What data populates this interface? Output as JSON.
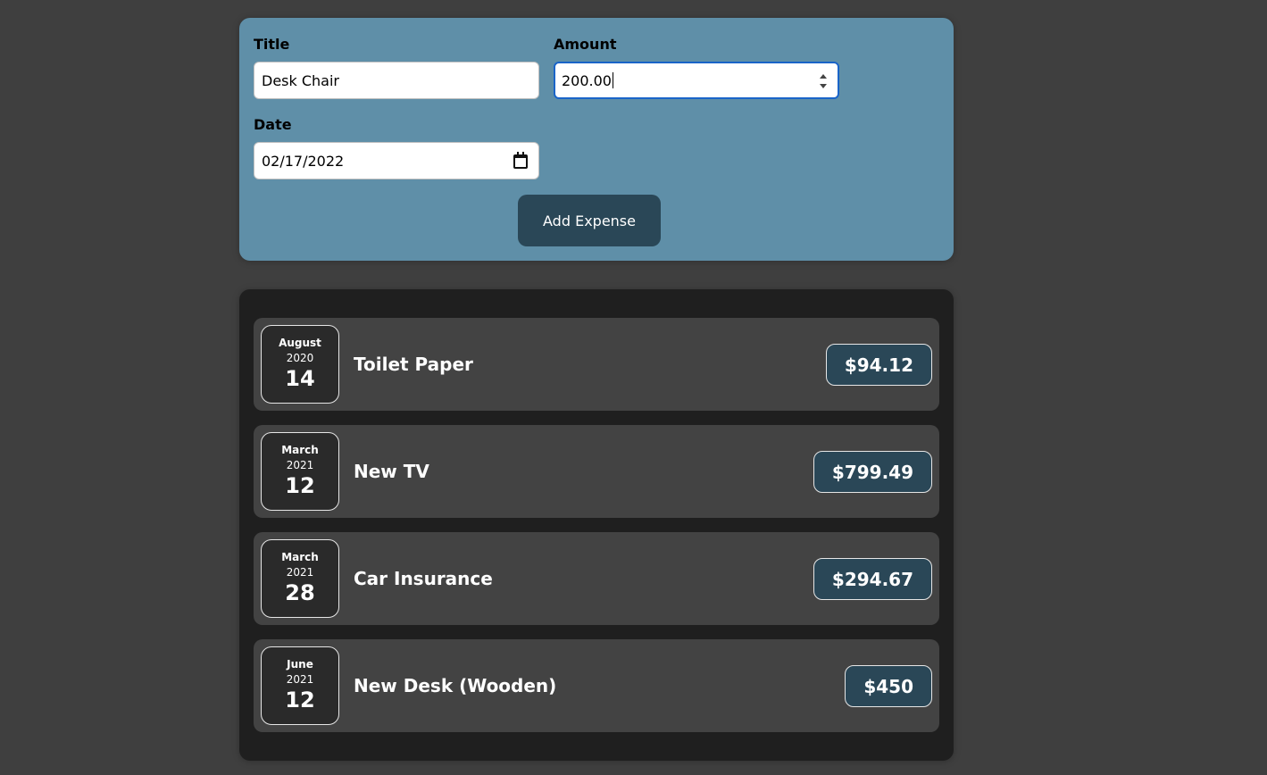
{
  "form": {
    "title_label": "Title",
    "title_value": "Desk Chair",
    "amount_label": "Amount",
    "amount_value": "200.00",
    "date_label": "Date",
    "date_value": "02/17/2022",
    "submit_label": "Add Expense"
  },
  "expenses": [
    {
      "month": "August",
      "year": "2020",
      "day": "14",
      "title": "Toilet Paper",
      "amount": "$94.12"
    },
    {
      "month": "March",
      "year": "2021",
      "day": "12",
      "title": "New TV",
      "amount": "$799.49"
    },
    {
      "month": "March",
      "year": "2021",
      "day": "28",
      "title": "Car Insurance",
      "amount": "$294.67"
    },
    {
      "month": "June",
      "year": "2021",
      "day": "12",
      "title": "New Desk (Wooden)",
      "amount": "$450"
    }
  ],
  "colors": {
    "page_background": "#3f3f3f",
    "form_background": "#5f8fa8",
    "list_background": "#1f1f1f",
    "item_background": "#434343",
    "accent_dark": "#2a4757",
    "focus_ring": "#1a64c8"
  },
  "icons": {
    "calendar": "calendar-icon",
    "spinner": "number-spinner-icon"
  }
}
